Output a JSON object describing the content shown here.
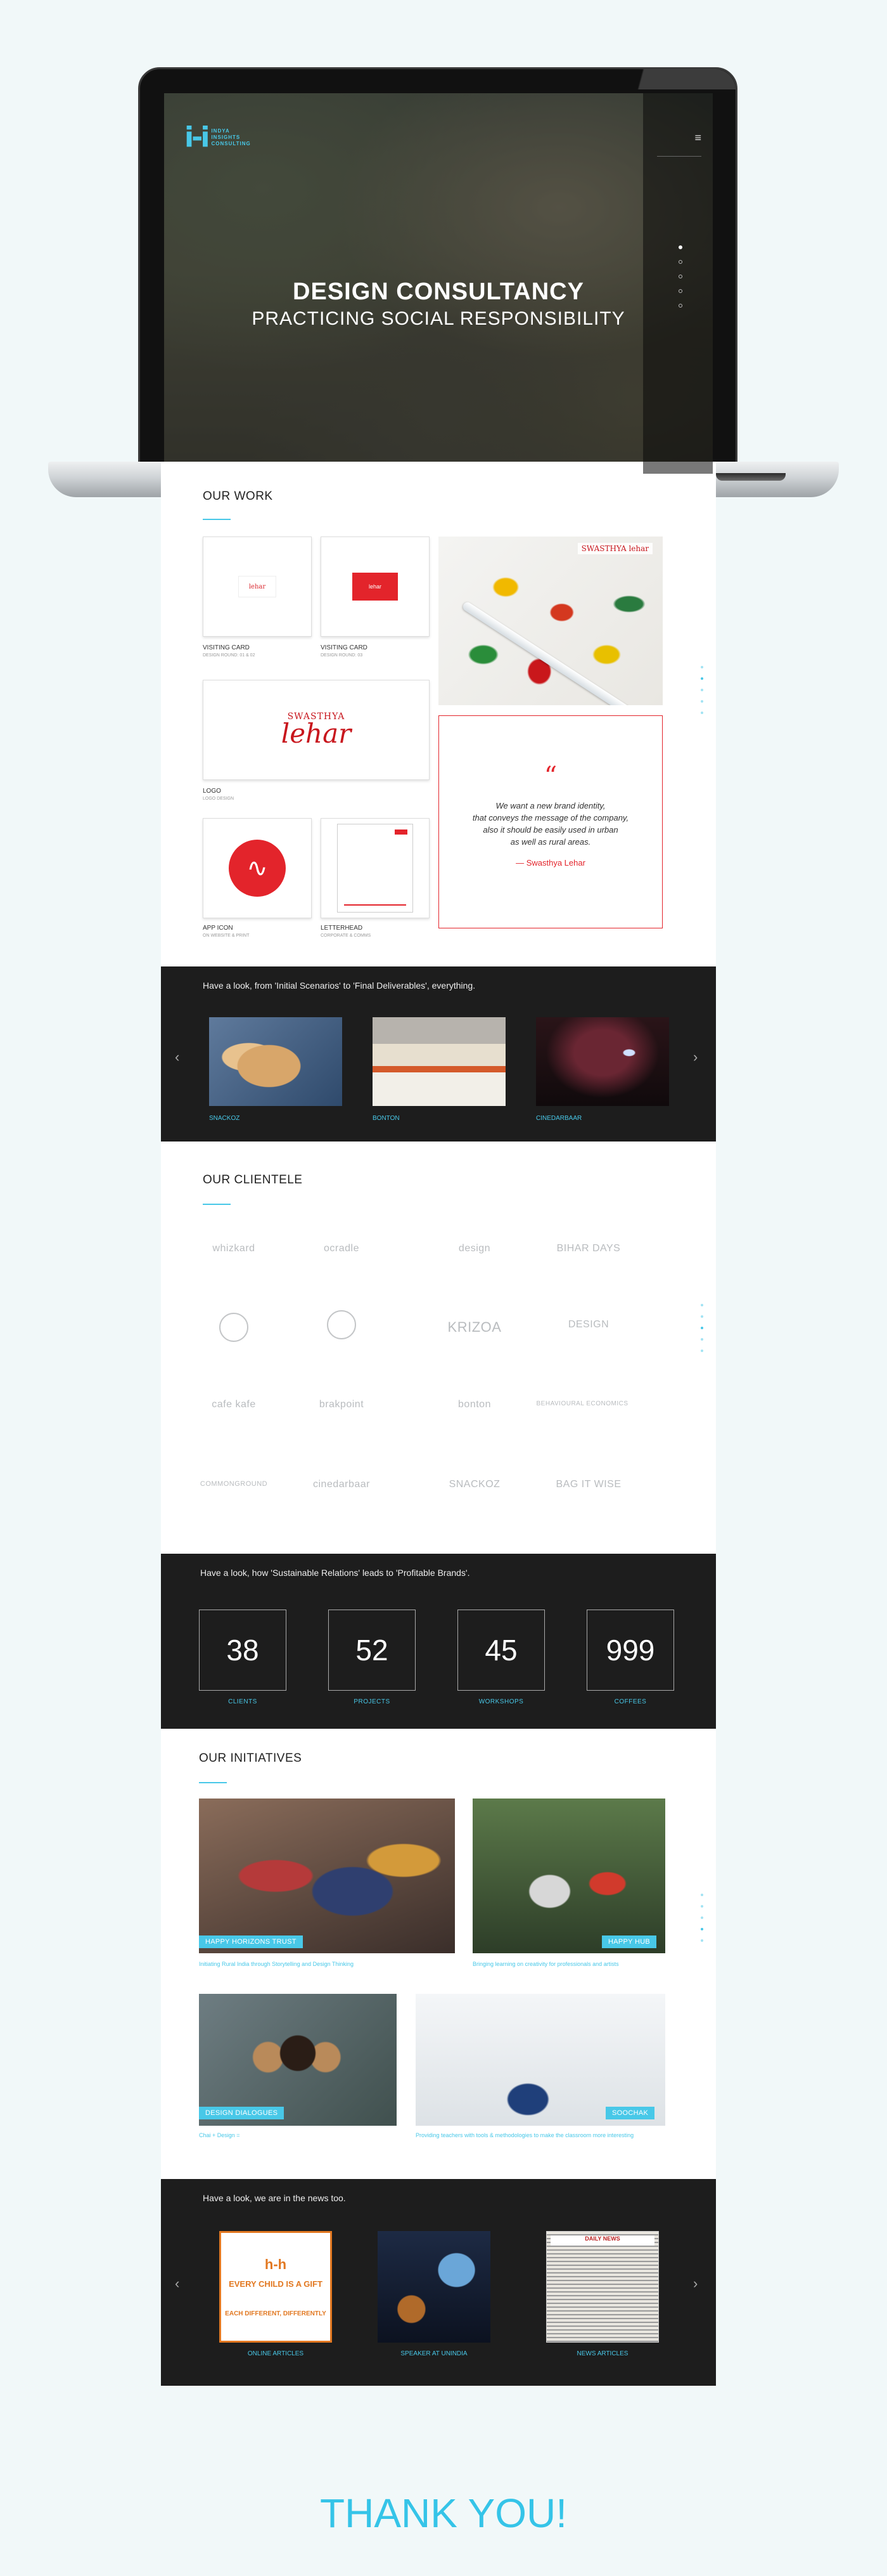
{
  "hero": {
    "logo_mark": "i-i",
    "logo_lines": [
      "INDYA",
      "INSIGHTS",
      "CONSULTING"
    ],
    "menu_icon": "hamburger-icon",
    "title": "DESIGN CONSULTANCY",
    "subtitle": "PRACTICING SOCIAL RESPONSIBILITY"
  },
  "work": {
    "heading": "OUR WORK",
    "items": [
      {
        "title": "VISITING CARD",
        "sub": "DESIGN ROUND: 01 & 02",
        "mark": "lehar"
      },
      {
        "title": "VISITING CARD",
        "sub": "DESIGN ROUND: 03"
      },
      {
        "title": "LOGO",
        "sub": "LOGO DESIGN"
      },
      {
        "title": "APP ICON",
        "sub": "ON WEBSITE & PRINT"
      },
      {
        "title": "LETTERHEAD",
        "sub": "CORPORATE & COMMS"
      }
    ],
    "logo_top": "SWASTHYA",
    "logo_main": "lehar",
    "app_icon_symbol": "∿",
    "pills_brand": "SWASTHYA lehar",
    "quote_mark": "“",
    "quote": "We want a new brand identity,\nthat conveys the message of the company,\nalso it should be easily used in urban\nas well as rural areas.",
    "quote_author": "—  Swasthya Lehar"
  },
  "scenarios": {
    "intro": "Have a look, from 'Initial Scenarios' to 'Final Deliverables', everything.",
    "prev_icon": "‹",
    "next_icon": "›",
    "slides": [
      {
        "caption": "SNACKOZ"
      },
      {
        "caption": "BONTON"
      },
      {
        "caption": "CINEDARBAAR"
      }
    ]
  },
  "clientele": {
    "heading": "OUR CLIENTELE",
    "rows": [
      [
        "whizkard",
        "ocradle",
        "design",
        "BIHAR DAYS"
      ],
      [
        "",
        "",
        "KRIZOA",
        "DESIGN"
      ],
      [
        "cafe kafe",
        "brakpoint",
        "bonton",
        "BEHAVIOURAL ECONOMICS"
      ],
      [
        "COMMONGROUND",
        "cinedarbaar",
        "SNACKOZ",
        "BAG IT WISE"
      ]
    ]
  },
  "counters": {
    "intro": "Have a look, how 'Sustainable Relations' leads to 'Profitable Brands'.",
    "items": [
      {
        "value": "38",
        "label": "CLIENTS"
      },
      {
        "value": "52",
        "label": "PROJECTS"
      },
      {
        "value": "45",
        "label": "WORKSHOPS"
      },
      {
        "value": "999",
        "label": "COFFEES"
      }
    ]
  },
  "initiatives": {
    "heading": "OUR INITIATIVES",
    "items": [
      {
        "tag": "HAPPY HORIZONS TRUST",
        "desc": "Initiating Rural India through Storytelling and Design Thinking"
      },
      {
        "tag": "HAPPY HUB",
        "desc": "Bringing learning on creativity for professionals and artists"
      },
      {
        "tag": "DESIGN DIALOGUES",
        "desc": "Chai + Design = "
      },
      {
        "tag": "SOOCHAK",
        "desc": "Providing teachers with tools & methodologies to make the classroom more interesting"
      }
    ]
  },
  "news": {
    "intro": "Have a look, we are in the news too.",
    "prev_icon": "‹",
    "next_icon": "›",
    "poster_logo": "h-h",
    "poster_line1": "EVERY CHILD IS A GIFT",
    "poster_line2": "EACH DIFFERENT, DIFFERENTLY",
    "paper_header": "DAILY NEWS",
    "items": [
      {
        "caption": "ONLINE ARTICLES"
      },
      {
        "caption": "SPEAKER AT UNINDIA"
      },
      {
        "caption": "NEWS ARTICLES"
      }
    ]
  },
  "thanks": "THANK YOU!"
}
